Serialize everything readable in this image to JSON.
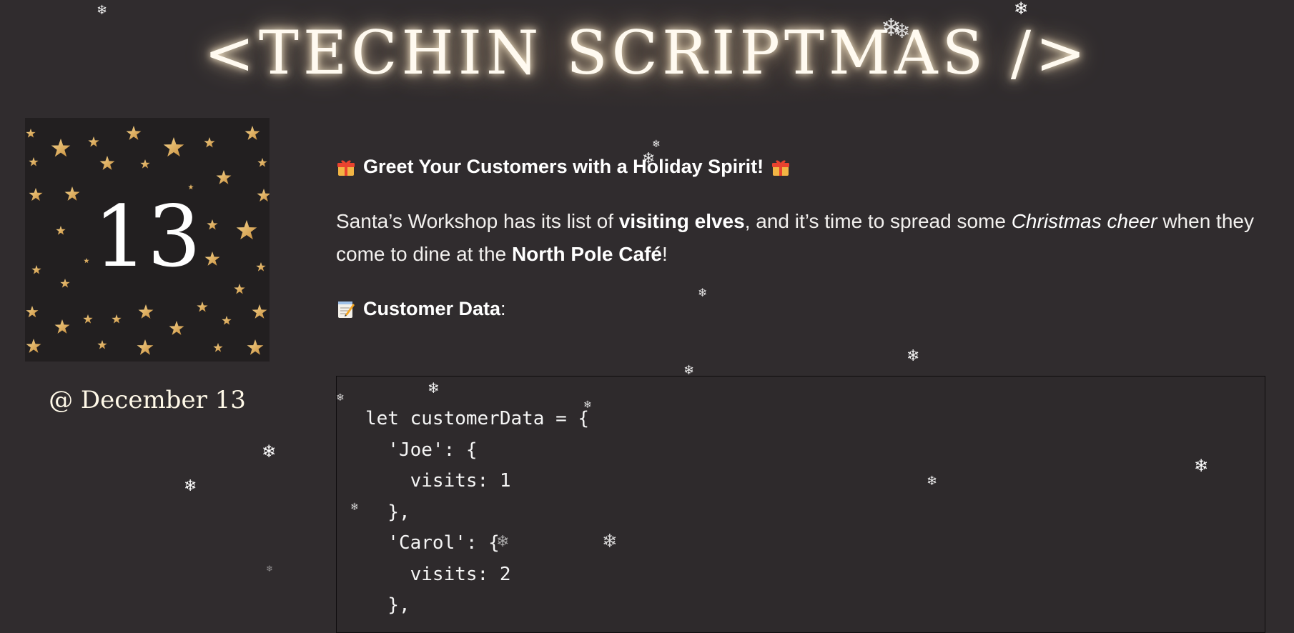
{
  "header": {
    "title": "<TECHIN SCRIPTMAS />"
  },
  "day_card": {
    "number": "13",
    "date_label": "@ December 13"
  },
  "post": {
    "headline": "Greet Your Customers with a Holiday Spirit!",
    "intro": {
      "part1": "Santa’s Workshop has its list of ",
      "bold1": "visiting elves",
      "part2": ", and it’s time to spread some ",
      "italic1": "Christmas cheer",
      "part3": " when they come to dine at the ",
      "bold2": "North Pole Café",
      "part4": "!"
    },
    "section_title": "Customer Data",
    "section_suffix": ":",
    "code_lines": [
      "let customerData = {",
      "  'Joe': {",
      "    visits: 1",
      "  },",
      "  'Carol': {",
      "    visits: 2",
      "  },"
    ]
  },
  "icons": {
    "gift": "gift-icon",
    "memo": "memo-icon",
    "snowflake": "snowflake-icon"
  },
  "colors": {
    "background": "#302c2e",
    "star_gold": "#e2b768",
    "tile_background": "#221f20"
  }
}
